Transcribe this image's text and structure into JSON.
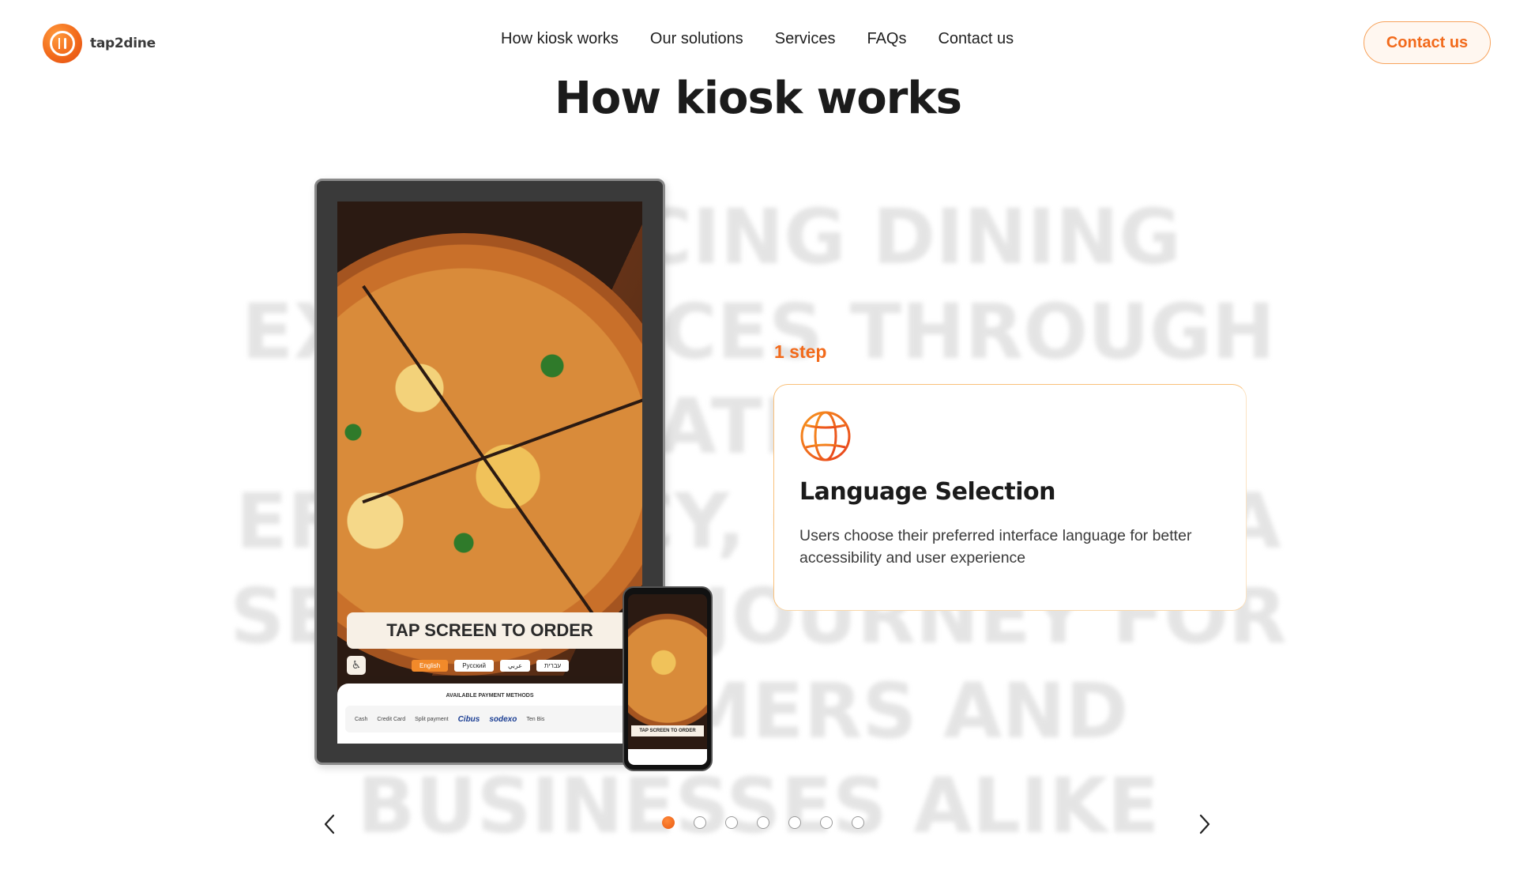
{
  "header": {
    "logo_text": "tap2dine",
    "nav": [
      "How kiosk works",
      "Our solutions",
      "Services",
      "FAQs",
      "Contact us"
    ],
    "contact_button": "Contact us"
  },
  "section": {
    "title": "How kiosk works",
    "background_text": "Enhancing dining experiences through innovation and efficiency, creating a seamless journey for customers and businesses alike"
  },
  "kiosk": {
    "tap_banner": "TAP SCREEN TO ORDER",
    "languages": [
      "English",
      "Русский",
      "عربي",
      "עברית"
    ],
    "payment_title": "AVAILABLE PAYMENT METHODS",
    "payment_methods": [
      "Cash",
      "Credit Card",
      "Split payment",
      "Cibus",
      "sodexo",
      "Ten Bis"
    ],
    "phone_banner": "TAP SCREEN TO ORDER"
  },
  "step": {
    "label": "1 step",
    "icon": "globe-icon",
    "title": "Language Selection",
    "description": "Users choose their preferred interface language for better accessibility and user experience"
  },
  "carousel": {
    "total_steps": 7,
    "active_step": 1
  },
  "colors": {
    "accent": "#f26a1b",
    "card_border": "#f9c07a",
    "text_dark": "#1b1b1b"
  }
}
